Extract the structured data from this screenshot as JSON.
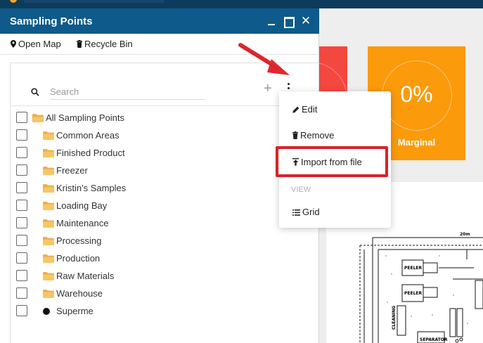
{
  "panel": {
    "title": "Sampling Points",
    "window_controls": [
      "minimize-icon",
      "maximize-icon",
      "close-icon"
    ],
    "close_glyph": "✕"
  },
  "toolbar": {
    "open_map_label": "Open Map",
    "open_map_icon": "map-pin-icon",
    "recycle_bin_label": "Recycle Bin",
    "recycle_bin_icon": "trash-icon"
  },
  "search": {
    "placeholder": "Search",
    "value": ""
  },
  "actions": {
    "add_glyph": "+",
    "more_icon": "kebab-menu-icon"
  },
  "tree": {
    "items": [
      {
        "label": "All Sampling Points",
        "icon": "folder-open-icon"
      },
      {
        "label": "Common Areas",
        "icon": "folder-icon"
      },
      {
        "label": "Finished Product",
        "icon": "folder-icon"
      },
      {
        "label": "Freezer",
        "icon": "folder-icon"
      },
      {
        "label": "Kristin's Samples",
        "icon": "folder-open-icon"
      },
      {
        "label": "Loading Bay",
        "icon": "folder-icon"
      },
      {
        "label": "Maintenance",
        "icon": "folder-icon"
      },
      {
        "label": "Processing",
        "icon": "folder-icon"
      },
      {
        "label": "Production",
        "icon": "folder-icon"
      },
      {
        "label": "Raw Materials",
        "icon": "folder-icon"
      },
      {
        "label": "Warehouse",
        "icon": "folder-icon"
      },
      {
        "label": "Superme",
        "icon": "dot-icon"
      }
    ]
  },
  "menu": {
    "edit_label": "Edit",
    "remove_label": "Remove",
    "import_label": "Import from file",
    "view_section": "VIEW",
    "grid_label": "Grid"
  },
  "dashboard": {
    "marginal_value": "0%",
    "marginal_label": "Marginal"
  },
  "floor_plan": {
    "labels": [
      "20m",
      "PEELER",
      "PEELER",
      "CLEANING",
      "SEPARATOR"
    ]
  },
  "colors": {
    "title_bar": "#0e5a8a",
    "app_header": "#0d3b5c",
    "tile_red": "#f4473f",
    "tile_orange": "#fb9a0b",
    "highlight": "#d8232a",
    "folder": "#f6c667"
  }
}
